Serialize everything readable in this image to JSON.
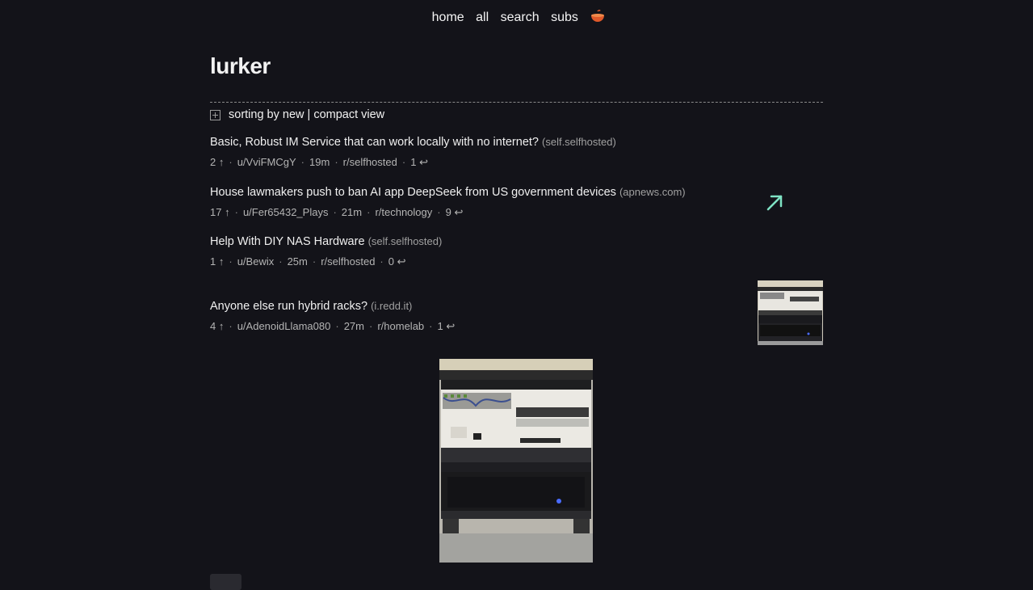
{
  "nav": {
    "home": "home",
    "all": "all",
    "search": "search",
    "subs": "subs",
    "logo_icon": "bowl-icon"
  },
  "page": {
    "title": "lurker",
    "sort_text": "sorting by new | compact view"
  },
  "posts": [
    {
      "title": "Basic, Robust IM Service that can work locally with no internet?",
      "domain": "(self.selfhosted)",
      "score": "2",
      "author": "u/VviFMCgY",
      "age": "19m",
      "subreddit": "r/selfhosted",
      "comments": "1"
    },
    {
      "title": "House lawmakers push to ban AI app DeepSeek from US government devices",
      "domain": "(apnews.com)",
      "score": "17",
      "author": "u/Fer65432_Plays",
      "age": "21m",
      "subreddit": "r/technology",
      "comments": "9"
    },
    {
      "title": "Help With DIY NAS Hardware",
      "domain": "(self.selfhosted)",
      "score": "1",
      "author": "u/Bewix",
      "age": "25m",
      "subreddit": "r/selfhosted",
      "comments": "0"
    },
    {
      "title": "Anyone else run hybrid racks?",
      "domain": "(i.redd.it)",
      "score": "4",
      "author": "u/AdenoidLlama080",
      "age": "27m",
      "subreddit": "r/homelab",
      "comments": "1"
    }
  ],
  "colors": {
    "background": "#131319",
    "link_arrow": "#7fe3c4",
    "logo": "#e0592a"
  }
}
